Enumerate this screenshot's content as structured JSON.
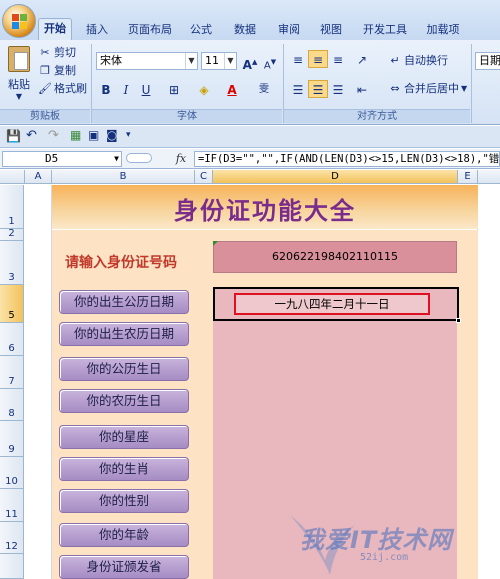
{
  "ribbon": {
    "tabs": [
      "开始",
      "插入",
      "页面布局",
      "公式",
      "数据",
      "审阅",
      "视图",
      "开发工具",
      "加载项"
    ],
    "active_tab": "开始",
    "clipboard": {
      "paste": "粘贴",
      "cut": "剪切",
      "copy": "复制",
      "format_painter": "格式刷",
      "group": "剪贴板"
    },
    "font": {
      "name": "宋体",
      "size": "11",
      "group": "字体"
    },
    "alignment": {
      "wrap": "自动换行",
      "merge": "合并后居中",
      "group": "对齐方式"
    },
    "number": {
      "format": "日期"
    }
  },
  "formula_bar": {
    "cell_ref": "D5",
    "fx": "fx",
    "formula": "=IF(D3=\"\",\"\",IF(AND(LEN(D3)<>15,LEN(D3)<>18),\"错"
  },
  "grid": {
    "columns": [
      "A",
      "B",
      "C",
      "D",
      "E"
    ],
    "rows": [
      "1",
      "2",
      "3",
      "5",
      "6",
      "7",
      "8",
      "9",
      "10",
      "11",
      "12"
    ]
  },
  "sheet": {
    "title": "身份证功能大全",
    "prompt": "请输入身份证号码",
    "id_number": "620622198402110115",
    "result": "一九八四年二月十一日",
    "buttons": [
      "你的出生公历日期",
      "你的出生农历日期",
      "你的公历生日",
      "你的农历生日",
      "你的星座",
      "你的生肖",
      "你的性别",
      "你的年龄",
      "身份证颁发省"
    ]
  },
  "watermark": {
    "text": "我爱IT技术网",
    "sub": "52ij.com"
  },
  "colors": {
    "title": "#7a2c8c",
    "prompt": "#c0392b",
    "button": "#a58cc3",
    "highlight_border": "#e01020"
  }
}
